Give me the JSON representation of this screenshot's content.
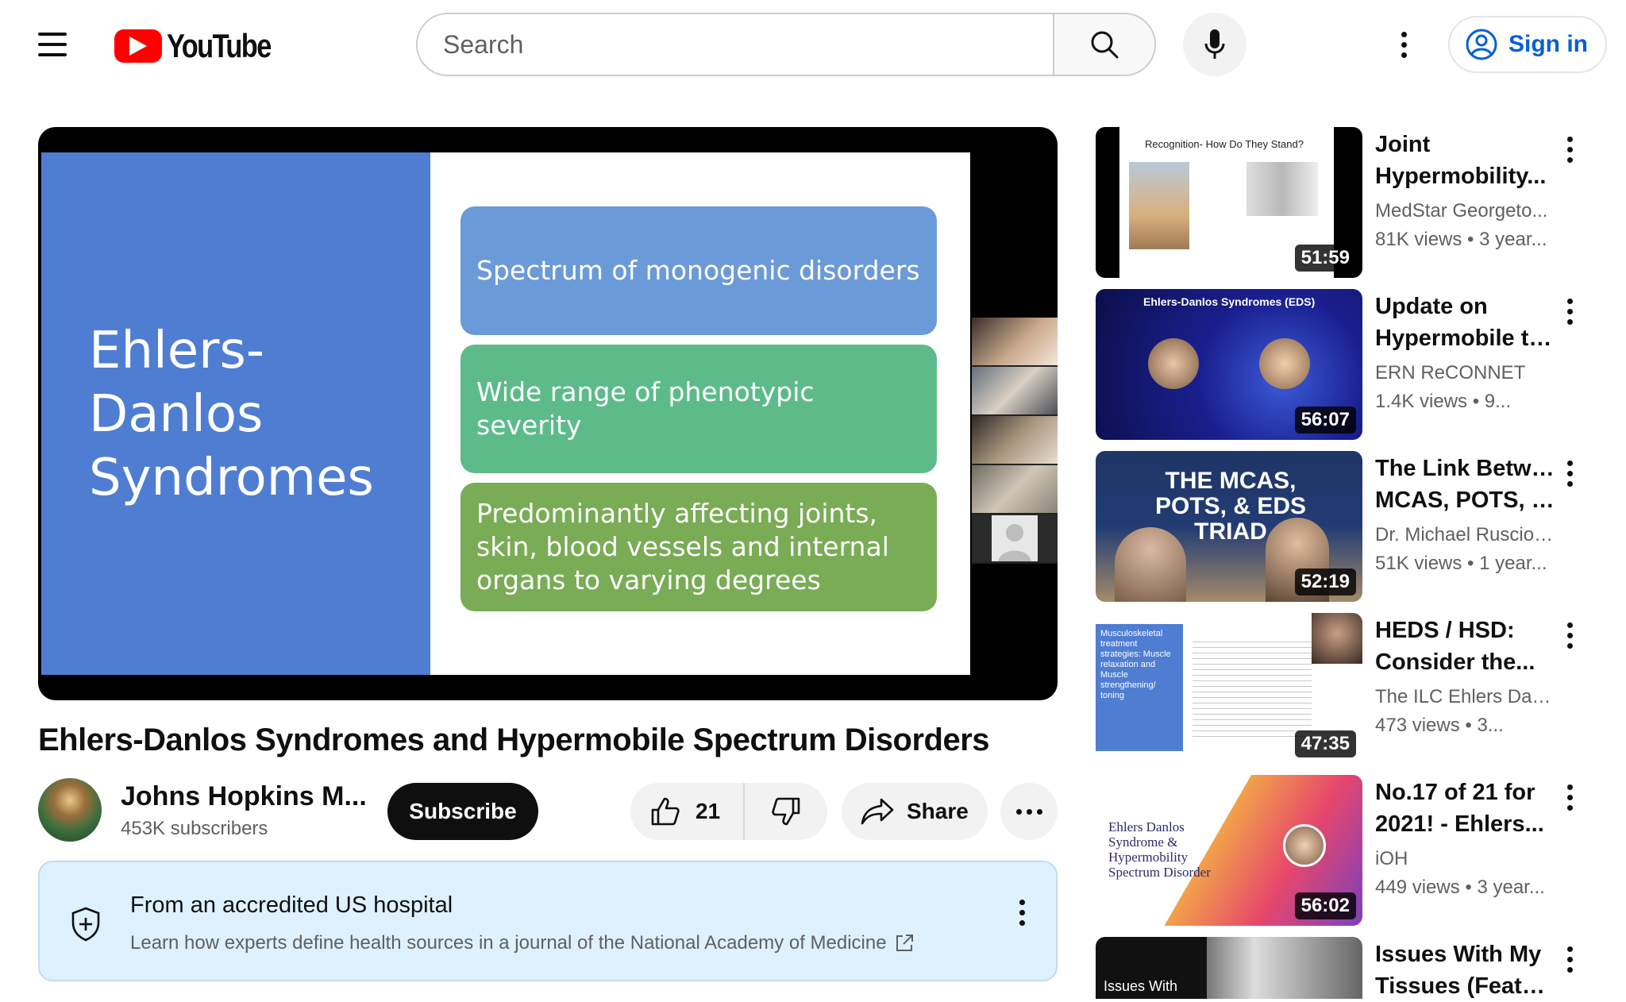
{
  "header": {
    "logo_text": "YouTube",
    "search_placeholder": "Search",
    "sign_in_label": "Sign in",
    "brand_color": "#ff0000",
    "link_color": "#065fd4"
  },
  "player": {
    "slide_title": "Ehlers-\nDanlos\nSyndromes",
    "boxes": [
      "Spectrum of monogenic disorders",
      "Wide range of phenotypic severity",
      "Predominantly affecting joints, skin, blood vessels and internal organs to varying degrees"
    ]
  },
  "video": {
    "title": "Ehlers-Danlos Syndromes and Hypermobile Spectrum Disorders",
    "channel_name": "Johns Hopkins M...",
    "subscribers": "453K subscribers",
    "subscribe_label": "Subscribe",
    "like_count": "21",
    "share_label": "Share"
  },
  "info_panel": {
    "title": "From an accredited US hospital",
    "subtitle": "Learn how experts define health sources in a journal of the National Academy of Medicine"
  },
  "recommendations": [
    {
      "title_line1": "Joint",
      "title_line2": "Hypermobility...",
      "channel": "MedStar Georgeto...",
      "meta": "81K views  • 3 year...",
      "duration": "51:59",
      "thumb_text": "Recognition- How Do They Stand?"
    },
    {
      "title_line1": "Update on",
      "title_line2": "Hypermobile ty...",
      "channel": "ERN ReCONNET",
      "meta": "1.4K views  • 9...",
      "duration": "56:07",
      "thumb_text": "Ehlers-Danlos Syndromes (EDS)"
    },
    {
      "title_line1": "The Link Between",
      "title_line2": "MCAS, POTS, a...",
      "channel": "Dr. Michael Ruscio, ...",
      "meta": "51K views  • 1 year...",
      "duration": "52:19",
      "thumb_text": "THE MCAS, POTS, & EDS TRIAD"
    },
    {
      "title_line1": "HEDS / HSD:",
      "title_line2": "Consider the...",
      "channel": "The ILC Ehlers Danl...",
      "meta": "473 views  • 3...",
      "duration": "47:35",
      "thumb_text": "Musculoskeletal treatment strategies: Muscle relaxation and Muscle strengthening/ toning"
    },
    {
      "title_line1": "No.17 of 21 for",
      "title_line2": "2021! - Ehlers...",
      "channel": "iOH",
      "meta": "449 views  • 3 year...",
      "duration": "56:02",
      "thumb_text": "Ehlers Danlos Syndrome & Hypermobility Spectrum Disorder"
    },
    {
      "title_line1": "Issues With My",
      "title_line2": "Tissues (Featur...",
      "channel": "",
      "meta": "",
      "duration": "",
      "thumb_text": "Issues With"
    }
  ]
}
